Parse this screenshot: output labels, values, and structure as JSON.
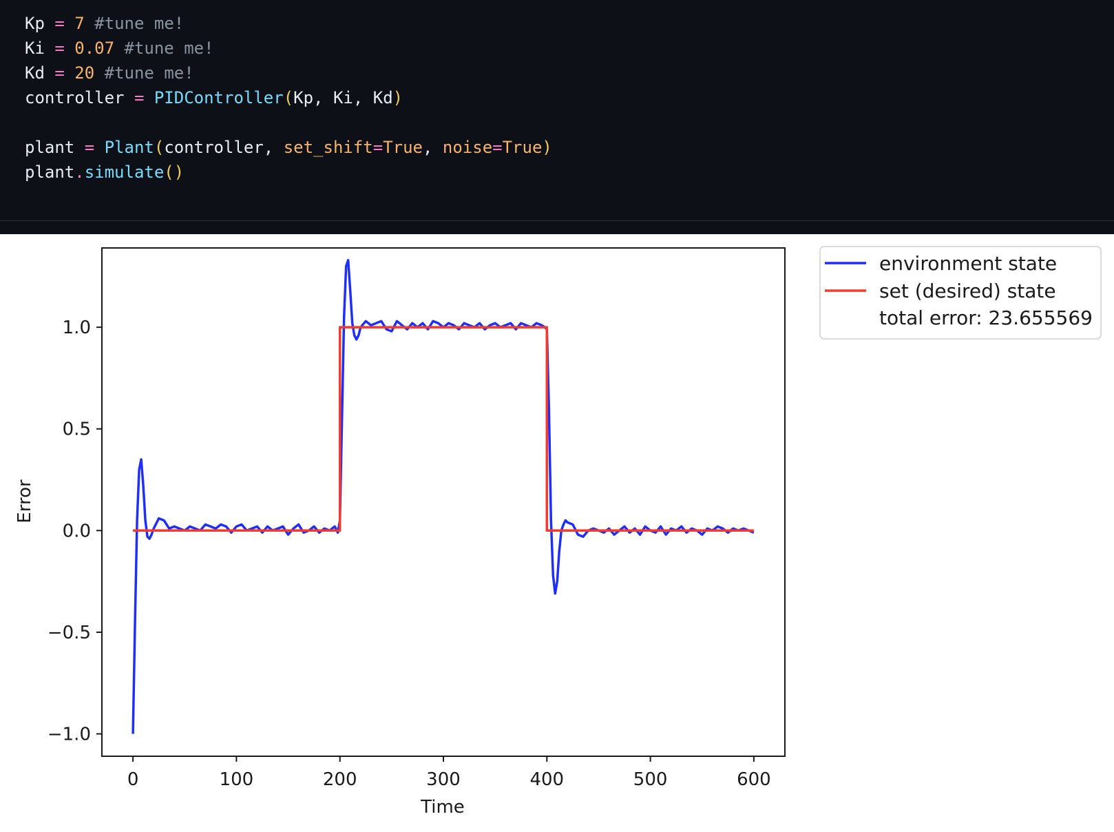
{
  "code": {
    "lines": [
      [
        {
          "t": "Kp",
          "c": "ident"
        },
        {
          "t": " = ",
          "c": "op"
        },
        {
          "t": "7",
          "c": "num"
        },
        {
          "t": " #tune me!",
          "c": "comment"
        }
      ],
      [
        {
          "t": "Ki",
          "c": "ident"
        },
        {
          "t": " = ",
          "c": "op"
        },
        {
          "t": "0.07",
          "c": "num"
        },
        {
          "t": " #tune me!",
          "c": "comment"
        }
      ],
      [
        {
          "t": "Kd",
          "c": "ident"
        },
        {
          "t": " = ",
          "c": "op"
        },
        {
          "t": "20",
          "c": "num"
        },
        {
          "t": " #tune me!",
          "c": "comment"
        }
      ],
      [
        {
          "t": "controller",
          "c": "ident"
        },
        {
          "t": " = ",
          "c": "op"
        },
        {
          "t": "PIDController",
          "c": "func"
        },
        {
          "t": "(",
          "c": "paren"
        },
        {
          "t": "Kp, Ki, Kd",
          "c": "ident"
        },
        {
          "t": ")",
          "c": "paren"
        }
      ],
      [],
      [
        {
          "t": "plant",
          "c": "ident"
        },
        {
          "t": " = ",
          "c": "op"
        },
        {
          "t": "Plant",
          "c": "func"
        },
        {
          "t": "(",
          "c": "paren"
        },
        {
          "t": "controller, ",
          "c": "ident"
        },
        {
          "t": "set_shift",
          "c": "kwarg"
        },
        {
          "t": "=",
          "c": "op"
        },
        {
          "t": "True",
          "c": "num"
        },
        {
          "t": ", ",
          "c": "ident"
        },
        {
          "t": "noise",
          "c": "kwarg"
        },
        {
          "t": "=",
          "c": "op"
        },
        {
          "t": "True",
          "c": "num"
        },
        {
          "t": ")",
          "c": "paren"
        }
      ],
      [
        {
          "t": "plant",
          "c": "ident"
        },
        {
          "t": ".",
          "c": "op"
        },
        {
          "t": "simulate",
          "c": "func"
        },
        {
          "t": "()",
          "c": "paren"
        }
      ]
    ]
  },
  "chart_data": {
    "type": "line",
    "title": "",
    "xlabel": "Time",
    "ylabel": "Error",
    "xlim": [
      -30,
      630
    ],
    "ylim": [
      -1.11,
      1.39
    ],
    "xticks": [
      0,
      100,
      200,
      300,
      400,
      500,
      600
    ],
    "xtick_labels": [
      "0",
      "100",
      "200",
      "300",
      "400",
      "500",
      "600"
    ],
    "yticks": [
      -1.0,
      -0.5,
      0.0,
      0.5,
      1.0
    ],
    "ytick_labels": [
      "−1.0",
      "−0.5",
      "0.0",
      "0.5",
      "1.0"
    ],
    "grid": false,
    "legend_position": "outside-top-right",
    "legend_entries": [
      "environment state",
      "set (desired) state"
    ],
    "legend_note": "total error: 23.655569",
    "colors": {
      "environment": "#1f2ff5",
      "setpoint": "#f23a2e"
    },
    "series": [
      {
        "name": "environment state",
        "x": [
          0,
          2,
          4,
          6,
          8,
          10,
          12,
          14,
          16,
          18,
          20,
          25,
          30,
          35,
          40,
          45,
          50,
          55,
          60,
          65,
          70,
          75,
          80,
          85,
          90,
          95,
          100,
          105,
          110,
          115,
          120,
          125,
          130,
          135,
          140,
          145,
          150,
          155,
          160,
          165,
          170,
          175,
          180,
          185,
          190,
          195,
          198,
          200,
          202,
          204,
          206,
          208,
          210,
          212,
          214,
          216,
          218,
          220,
          225,
          230,
          235,
          240,
          245,
          250,
          255,
          260,
          265,
          270,
          275,
          280,
          285,
          290,
          295,
          300,
          305,
          310,
          315,
          320,
          325,
          330,
          335,
          340,
          345,
          350,
          355,
          360,
          365,
          370,
          375,
          380,
          385,
          390,
          395,
          398,
          400,
          402,
          404,
          406,
          408,
          410,
          412,
          414,
          416,
          418,
          420,
          425,
          430,
          435,
          440,
          445,
          450,
          455,
          460,
          465,
          470,
          475,
          480,
          485,
          490,
          495,
          500,
          505,
          510,
          515,
          520,
          525,
          530,
          535,
          540,
          545,
          550,
          555,
          560,
          565,
          570,
          575,
          580,
          585,
          590,
          595,
          600
        ],
        "y": [
          -1.0,
          -0.45,
          0.05,
          0.3,
          0.35,
          0.22,
          0.05,
          -0.03,
          -0.04,
          -0.02,
          0.01,
          0.06,
          0.05,
          0.01,
          0.02,
          0.01,
          0.0,
          0.02,
          0.01,
          0.0,
          0.03,
          0.02,
          0.01,
          0.03,
          0.02,
          -0.01,
          0.02,
          0.03,
          0.0,
          0.01,
          0.02,
          -0.01,
          0.02,
          0.0,
          0.01,
          0.02,
          -0.02,
          0.01,
          0.03,
          -0.01,
          0.0,
          0.02,
          -0.01,
          0.01,
          0.0,
          0.02,
          -0.01,
          0.05,
          0.55,
          1.05,
          1.3,
          1.33,
          1.18,
          1.02,
          0.96,
          0.94,
          0.96,
          1.0,
          1.03,
          1.01,
          1.02,
          1.03,
          0.99,
          0.98,
          1.03,
          1.01,
          0.99,
          1.02,
          1.0,
          1.02,
          0.99,
          1.03,
          1.02,
          1.0,
          1.02,
          1.01,
          0.99,
          1.02,
          1.01,
          1.0,
          1.02,
          0.99,
          1.01,
          1.02,
          1.0,
          1.01,
          1.02,
          0.99,
          1.02,
          1.01,
          1.0,
          1.02,
          1.01,
          1.0,
          0.99,
          0.6,
          0.05,
          -0.22,
          -0.31,
          -0.25,
          -0.1,
          0.0,
          0.03,
          0.05,
          0.04,
          0.03,
          -0.02,
          -0.03,
          0.0,
          0.01,
          0.0,
          -0.01,
          0.01,
          -0.02,
          0.0,
          0.02,
          -0.01,
          0.01,
          -0.02,
          0.02,
          0.0,
          -0.01,
          0.02,
          -0.02,
          0.01,
          0.0,
          0.02,
          -0.01,
          0.01,
          0.0,
          -0.02,
          0.01,
          0.0,
          0.02,
          0.01,
          -0.01,
          0.01,
          0.0,
          0.01,
          0.0,
          -0.01
        ]
      },
      {
        "name": "set (desired) state",
        "x": [
          0,
          200,
          200,
          400,
          400,
          600
        ],
        "y": [
          0,
          0,
          1,
          1,
          0,
          0
        ]
      }
    ]
  }
}
